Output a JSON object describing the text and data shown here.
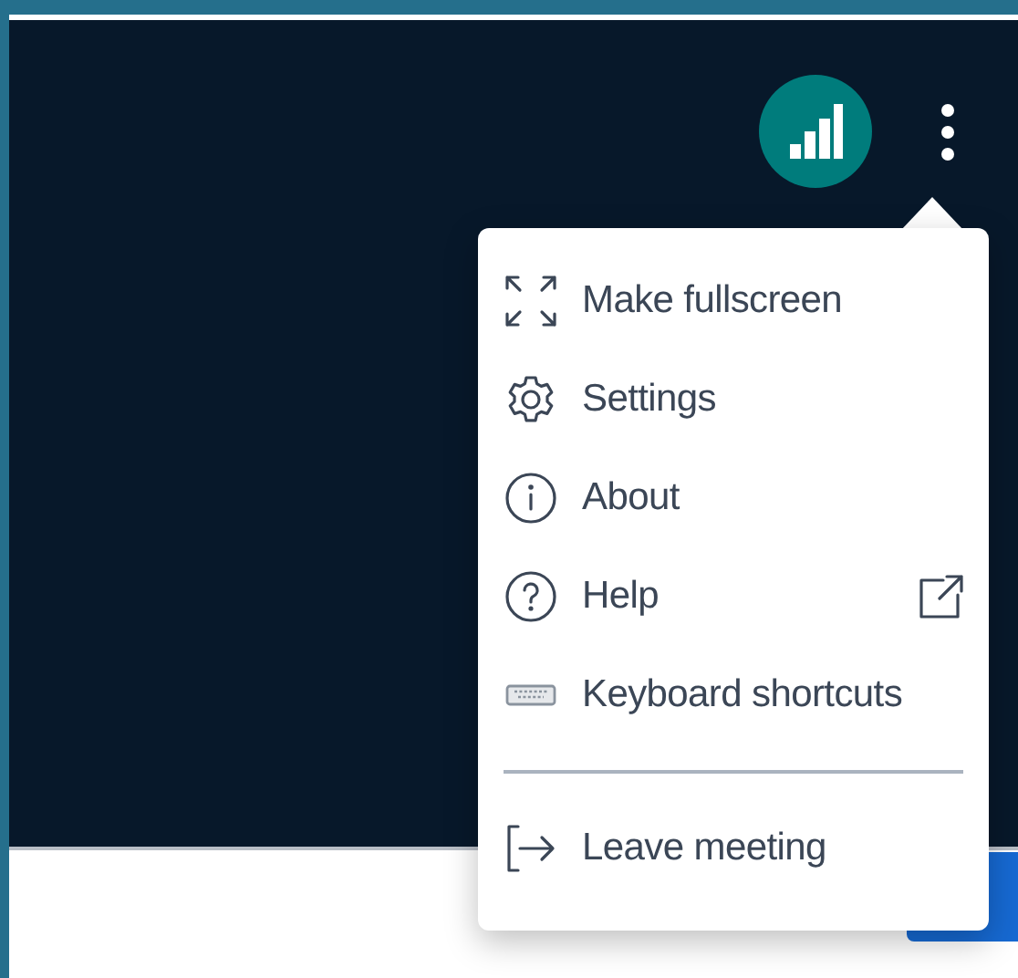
{
  "signal_button": {
    "kind": "signal"
  },
  "more_button": {
    "kind": "more"
  },
  "menu": {
    "items": [
      {
        "kind": "fullscreen",
        "label": "Make fullscreen",
        "external": false
      },
      {
        "kind": "settings",
        "label": "Settings",
        "external": false
      },
      {
        "kind": "about",
        "label": "About",
        "external": false
      },
      {
        "kind": "help",
        "label": "Help",
        "external": true
      },
      {
        "kind": "keyboard",
        "label": "Keyboard shortcuts",
        "external": false
      },
      {
        "kind": "divider"
      },
      {
        "kind": "leave",
        "label": "Leave meeting",
        "external": false
      }
    ]
  }
}
